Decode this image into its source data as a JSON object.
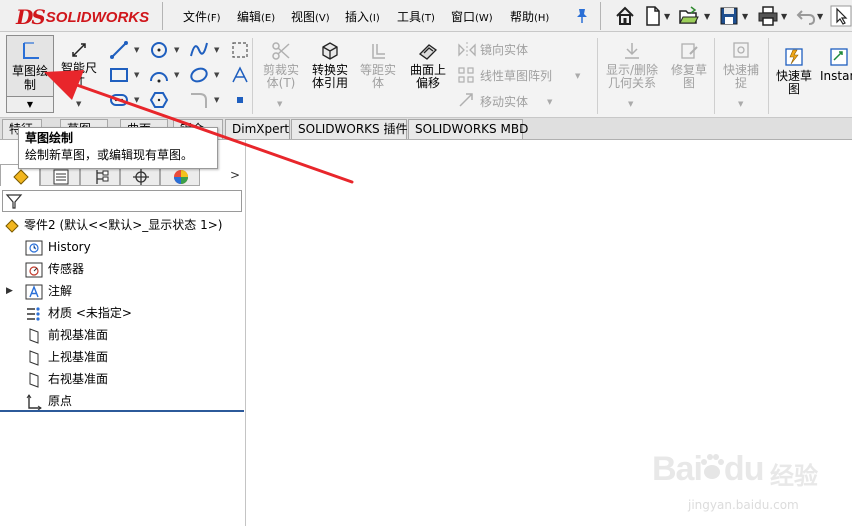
{
  "app": {
    "logo_ds": "DS",
    "logo_text": "SOLIDWORKS"
  },
  "menu": [
    {
      "label": "文件",
      "acc": "(F)"
    },
    {
      "label": "编辑",
      "acc": "(E)"
    },
    {
      "label": "视图",
      "acc": "(V)"
    },
    {
      "label": "插入",
      "acc": "(I)"
    },
    {
      "label": "工具",
      "acc": "(T)"
    },
    {
      "label": "窗口",
      "acc": "(W)"
    },
    {
      "label": "帮助",
      "acc": "(H)"
    }
  ],
  "quick_access_icons": [
    "home-icon",
    "new-document-icon",
    "open-icon",
    "save-icon",
    "print-icon",
    "undo-icon",
    "select-icon"
  ],
  "command_manager": {
    "sketch": {
      "label": "草图绘\n制",
      "line1": "草图绘",
      "line2": "制"
    },
    "smart_dimension": {
      "line1": "智能尺",
      "line2": "寸"
    },
    "trim": {
      "line1": "剪裁实",
      "line2": "体(T)"
    },
    "convert": {
      "line1": "转换实",
      "line2": "体引用"
    },
    "offset": {
      "line1": "等距实",
      "line2": "体"
    },
    "offset_surface": {
      "line1": "曲面上",
      "line2": "偏移"
    },
    "mirror": "镜向实体",
    "linear_pattern": "线性草图阵列",
    "move": "移动实体",
    "show_relations": {
      "line1": "显示/删除",
      "line2": "几何关系"
    },
    "repair": {
      "line1": "修复草",
      "line2": "图"
    },
    "quick_snaps": {
      "line1": "快速捕",
      "line2": "捉"
    },
    "rapid_sketch": {
      "line1": "快速草",
      "line2": "图"
    },
    "instant2d": {
      "line1": "Instan"
    }
  },
  "tabs": [
    "特征",
    "草图",
    "曲面",
    "钣金",
    "DimXpert",
    "SOLIDWORKS 插件",
    "SOLIDWORKS MBD"
  ],
  "tooltip": {
    "title": "草图绘制",
    "body": "绘制新草图，或编辑现有草图。"
  },
  "feature_tree": {
    "root": "零件2 (默认<<默认>_显示状态 1>)",
    "items": [
      {
        "label": "History",
        "icon": "history-icon"
      },
      {
        "label": "传感器",
        "icon": "sensor-icon"
      },
      {
        "label": "注解",
        "icon": "annotation-icon",
        "expandable": true
      },
      {
        "label": "材质 <未指定>",
        "icon": "material-icon"
      },
      {
        "label": "前视基准面",
        "icon": "plane-icon"
      },
      {
        "label": "上视基准面",
        "icon": "plane-icon"
      },
      {
        "label": "右视基准面",
        "icon": "plane-icon"
      },
      {
        "label": "原点",
        "icon": "origin-icon"
      }
    ]
  },
  "watermark": {
    "brand": "Bai",
    "brand2": "du",
    "jingyan": "经验",
    "url": "jingyan.baidu.com"
  },
  "colors": {
    "accent_red": "#d0161b",
    "arrow_red": "#e8262b",
    "tree_bottom_line": "#2c5a9a"
  }
}
